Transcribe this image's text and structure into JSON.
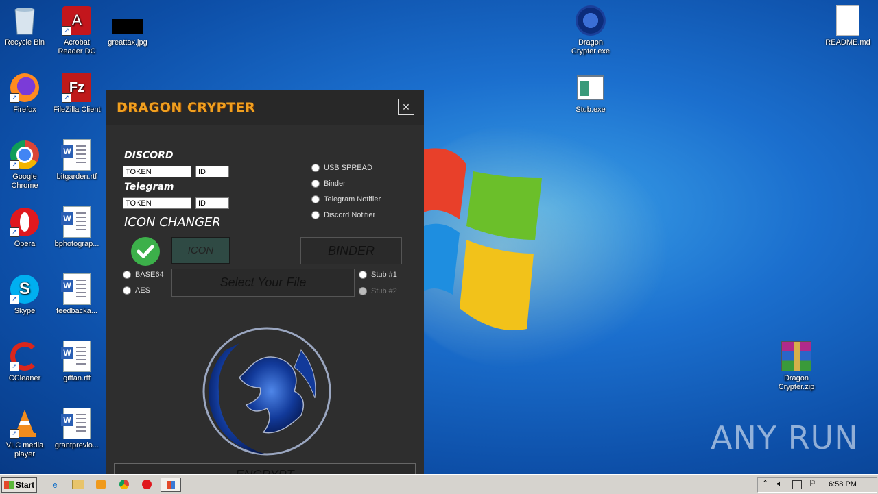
{
  "desktop": {
    "icons": [
      {
        "label": "Recycle Bin"
      },
      {
        "label": "Acrobat Reader DC"
      },
      {
        "label": "greattax.jpg"
      },
      {
        "label": "Firefox"
      },
      {
        "label": "FileZilla Client"
      },
      {
        "label": "Google Chrome"
      },
      {
        "label": "bitgarden.rtf"
      },
      {
        "label": "Opera"
      },
      {
        "label": "bphotograp..."
      },
      {
        "label": "Skype"
      },
      {
        "label": "feedbacka..."
      },
      {
        "label": "CCleaner"
      },
      {
        "label": "giftan.rtf"
      },
      {
        "label": "VLC media player"
      },
      {
        "label": "grantprevio..."
      },
      {
        "label": "Dragon Crypter.exe"
      },
      {
        "label": "Stub.exe"
      },
      {
        "label": "README.md"
      },
      {
        "label": "Dragon Crypter.zip"
      }
    ],
    "watermark": "ANY RUN"
  },
  "app": {
    "title": "DRAGON CRYPTER",
    "close_glyph": "✕",
    "discord_label": "DISCORD",
    "discord_token": "TOKEN",
    "discord_id": "ID",
    "telegram_label": "Telegram",
    "telegram_token": "TOKEN",
    "telegram_id": "ID",
    "icon_changer_label": "ICON CHANGER",
    "options": [
      "USB SPREAD",
      "Binder",
      "Telegram Notifier",
      "Discord Notifier"
    ],
    "icon_button": "ICON",
    "binder_button": "BINDER",
    "encoding": [
      "BASE64",
      "AES"
    ],
    "select_file_button": "Select Your File",
    "stubs": [
      "Stub #1",
      "Stub #2"
    ],
    "encrypt_button": "ENCRYPT",
    "check_icon": "check-icon",
    "logo_icon": "dragon-logo"
  },
  "taskbar": {
    "start_label": "Start",
    "clock": "6:58 PM"
  }
}
